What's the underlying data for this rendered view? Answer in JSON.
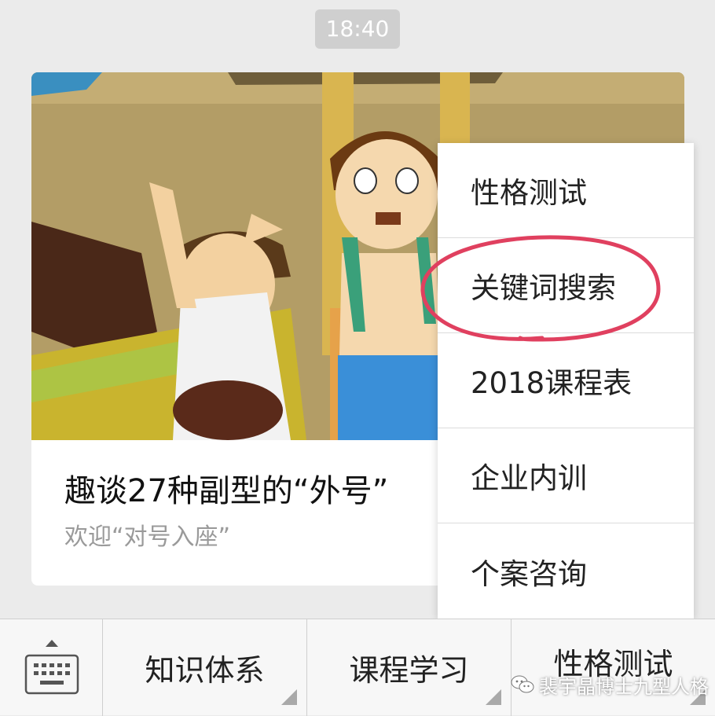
{
  "chat": {
    "timestamp": "18:40",
    "card": {
      "title": "趣谈27种副型的“外号”",
      "subtitle": "欢迎“对号入座”"
    }
  },
  "popup_menu": {
    "items": [
      "性格测试",
      "关键词搜索",
      "2018课程表",
      "企业内训",
      "个案咨询"
    ],
    "highlighted_item": "关键词搜索"
  },
  "bottom_menu": {
    "tabs": [
      "知识体系",
      "课程学习",
      "性格测试"
    ]
  },
  "watermark": {
    "text": "裴宇晶博士九型人格"
  },
  "icons": {
    "keyboard": "keyboard-icon",
    "watermark": "wechat-logo-icon"
  },
  "colors": {
    "highlight_circle": "#e0405f",
    "background": "#ebebeb"
  }
}
